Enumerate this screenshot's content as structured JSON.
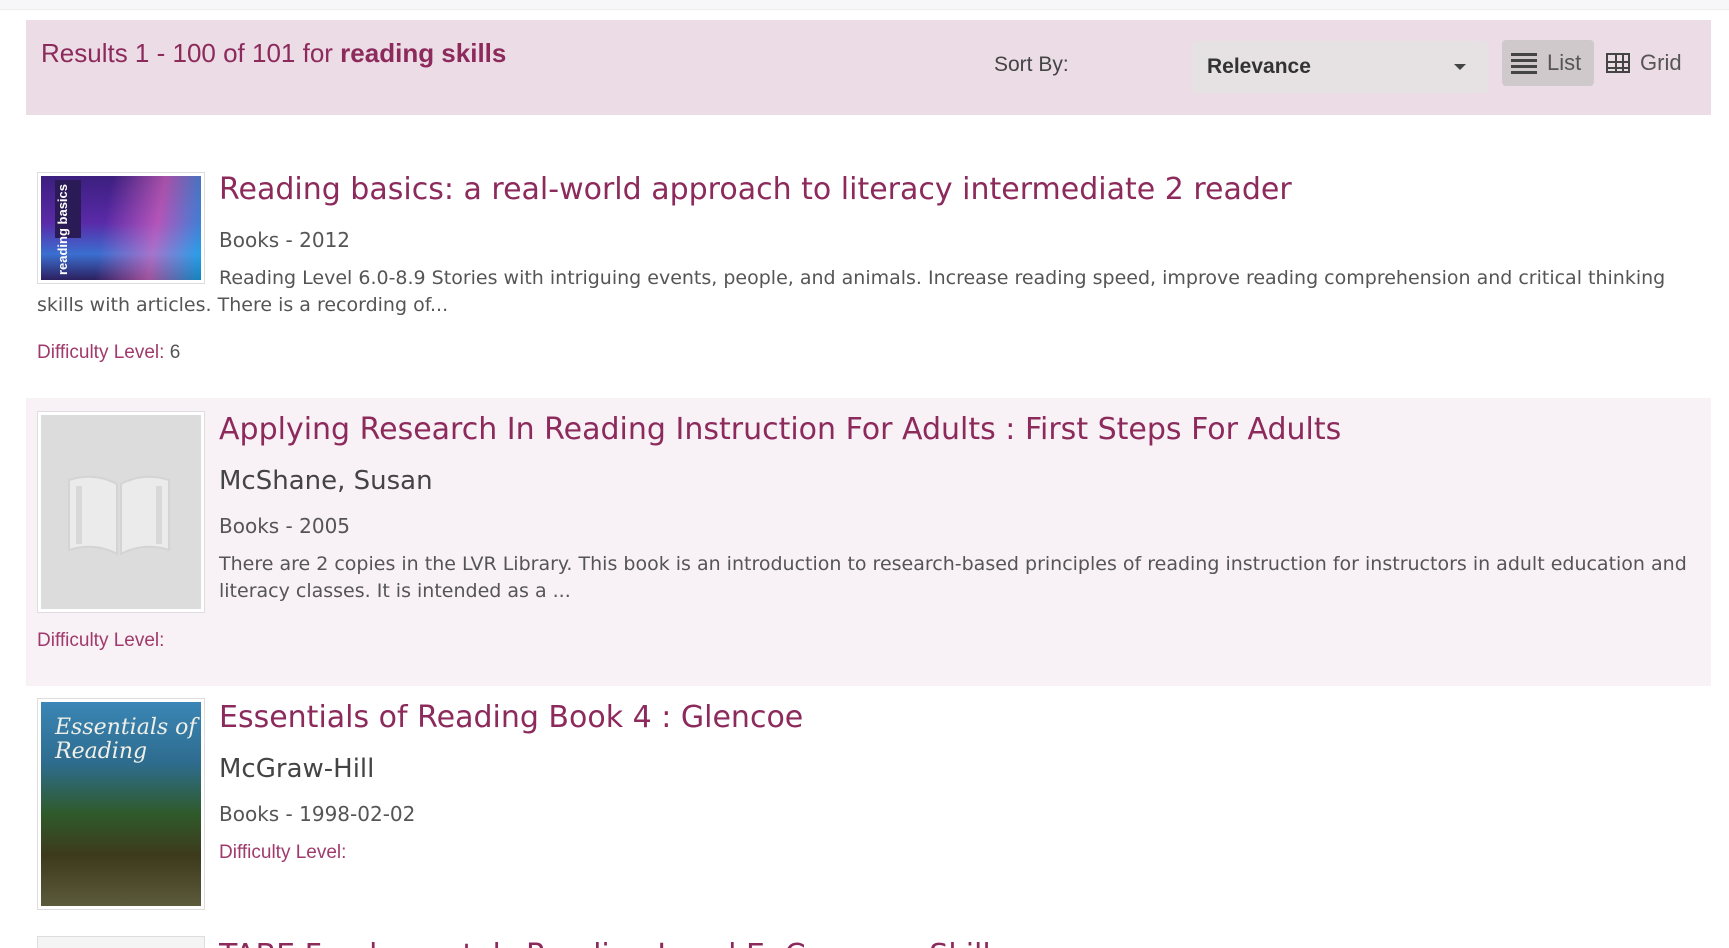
{
  "results_bar": {
    "prefix": "Results 1 - 100 of 101 for ",
    "query": "reading skills",
    "sort_label": "Sort By:",
    "sort_value": "Relevance",
    "list_label": "List",
    "grid_label": "Grid"
  },
  "results": [
    {
      "title": "Reading basics: a real-world approach to literacy intermediate 2 reader",
      "meta": "Books - 2012",
      "description": "Reading Level 6.0-8.9 Stories with intriguing events, people, and animals. Increase reading speed, improve reading comprehension and critical thinking skills with articles. There is a recording of...",
      "difficulty_label": "Difficulty Level:",
      "difficulty_value": " 6",
      "cover_text": "reading basics"
    },
    {
      "title": "Applying Research In Reading Instruction For Adults : First Steps For Adults",
      "author": "McShane, Susan",
      "meta": "Books - 2005",
      "description": "There are 2 copies in the LVR Library. This book is an introduction to research-based principles of reading instruction for instructors in adult education and literacy classes. It is intended as a ...",
      "difficulty_label": "Difficulty Level:"
    },
    {
      "title": "Essentials of Reading Book 4 : Glencoe",
      "author": "McGraw-Hill",
      "meta": "Books - 1998-02-02",
      "difficulty_label": "Difficulty Level:",
      "cover_text": "Essentials of Reading"
    }
  ],
  "partial_title": "TABE Fundamentals Reading Level E: Common Skills",
  "colors": {
    "accent": "#8c2a5c",
    "results_bar_bg": "#ecdce6",
    "alt_row_bg": "#f8f1f5"
  }
}
